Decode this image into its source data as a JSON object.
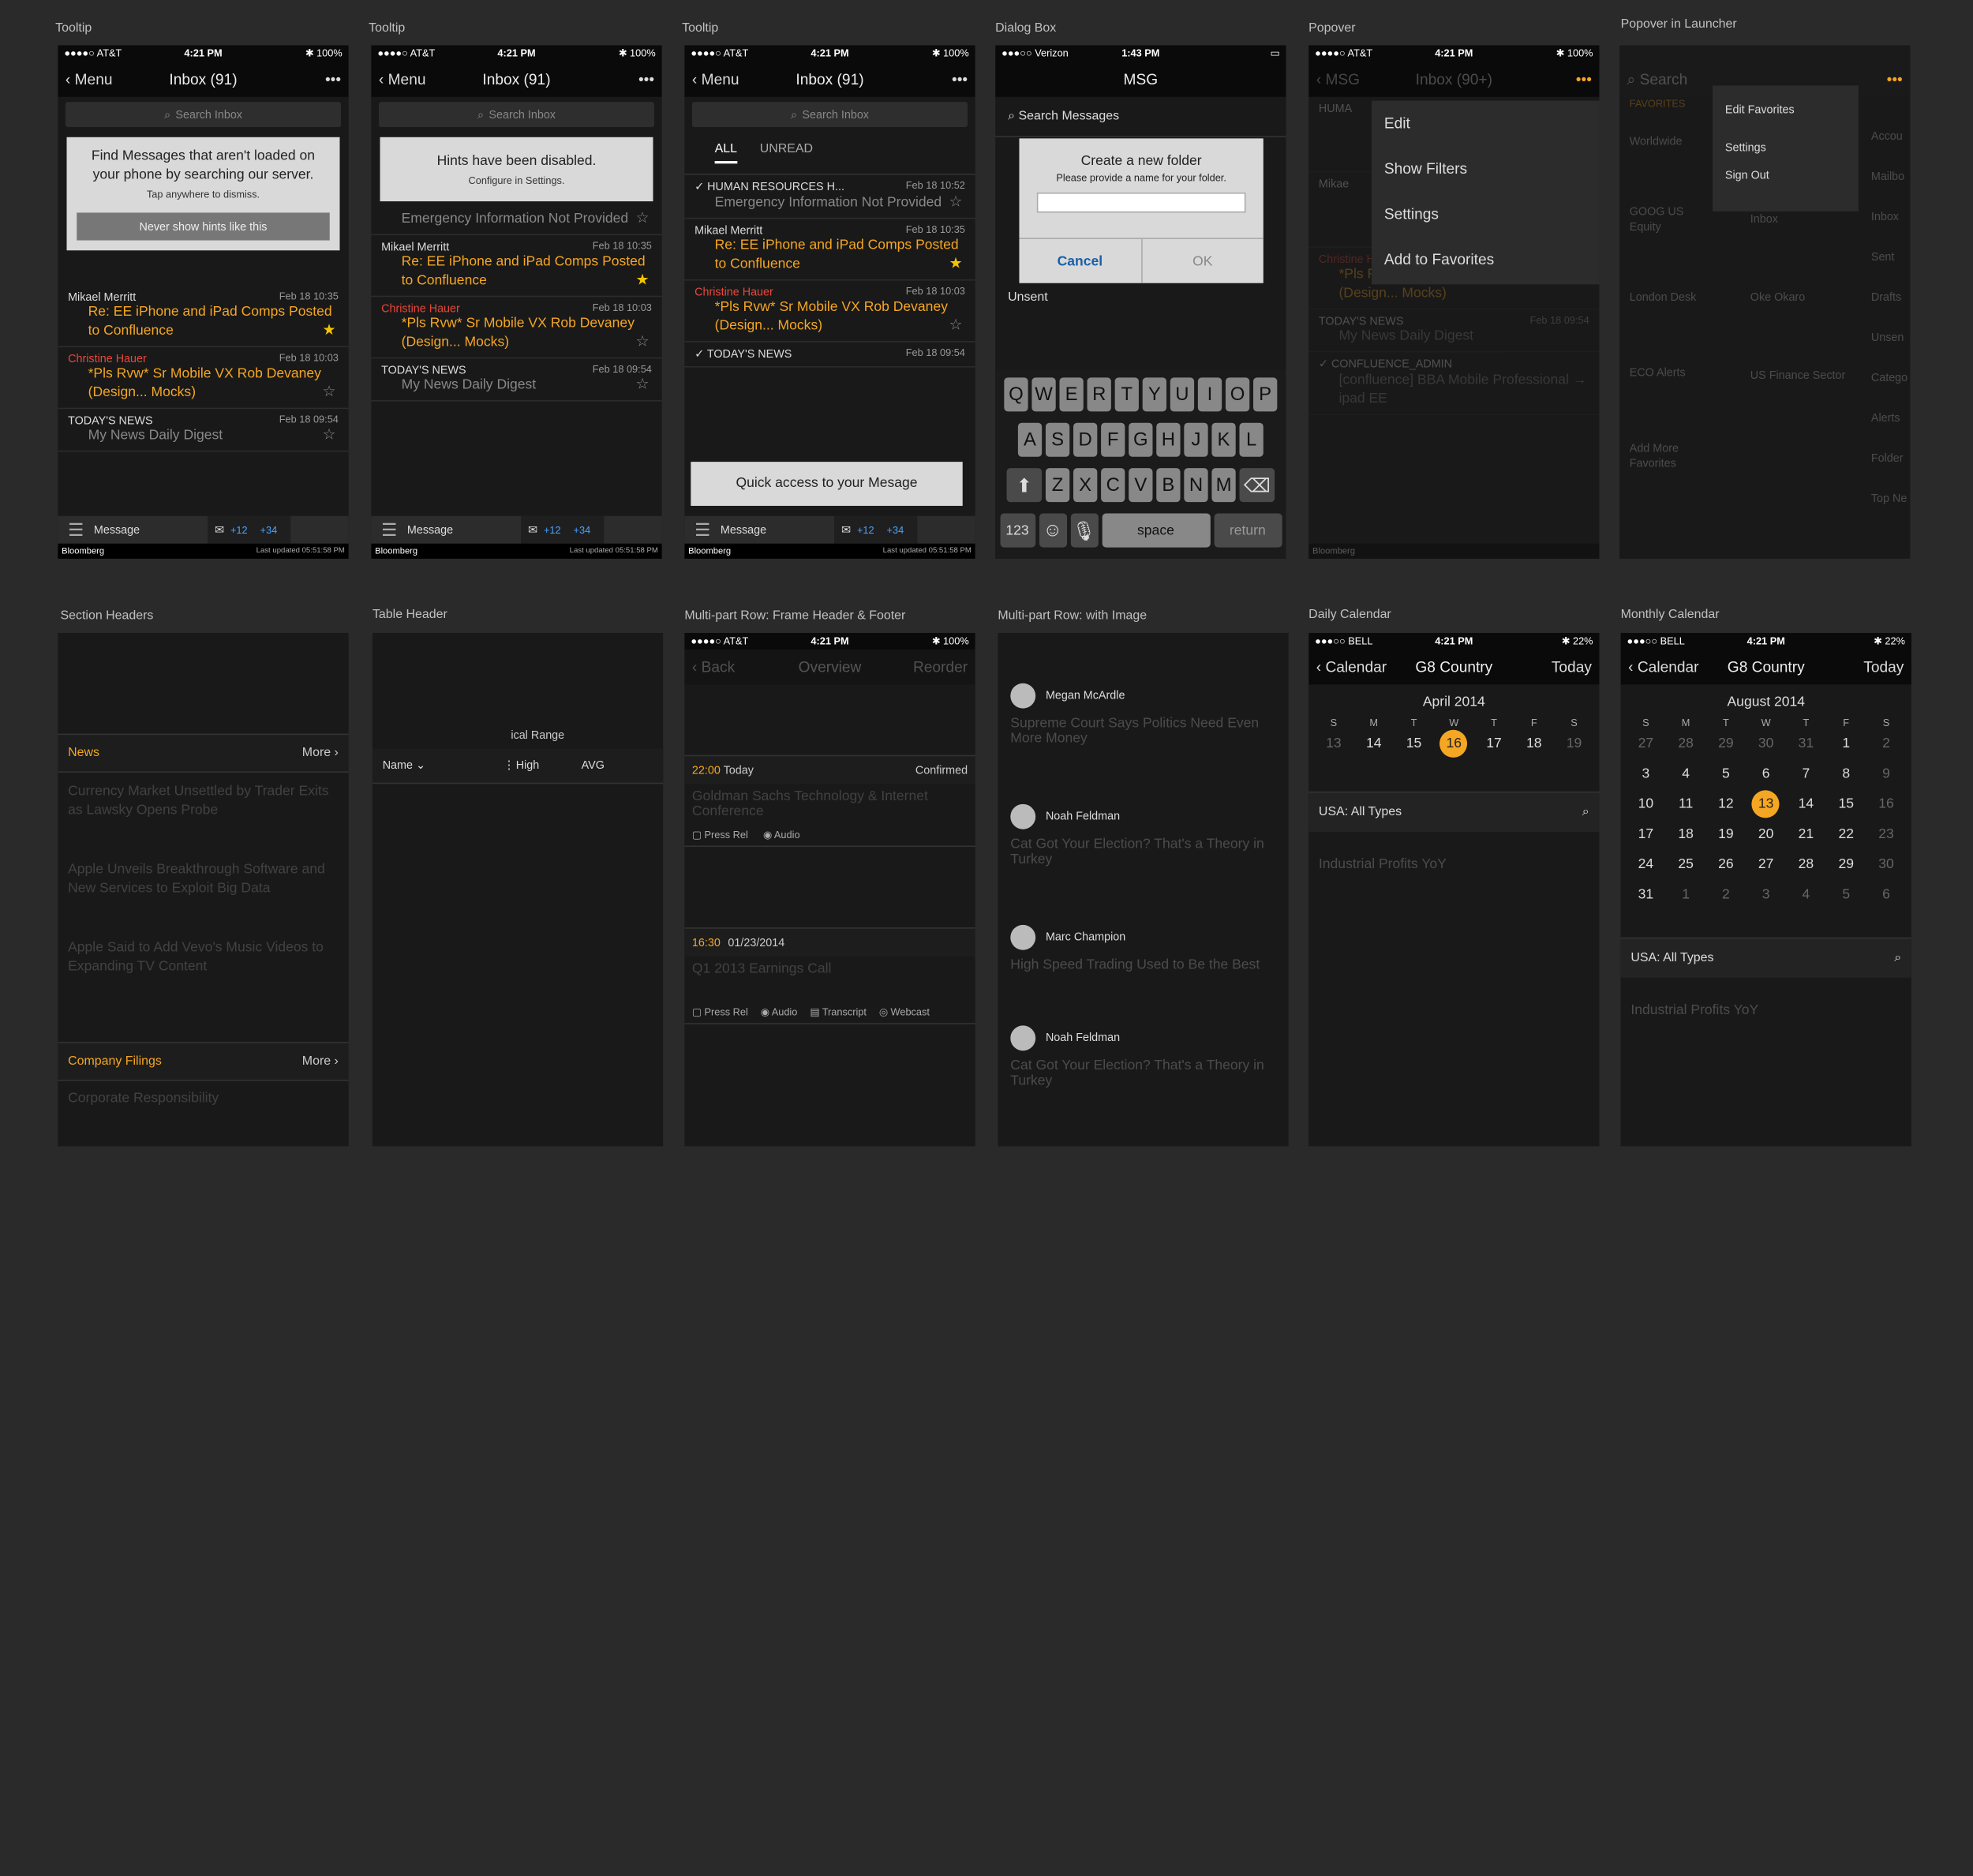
{
  "captions": {
    "c1": "Tooltip",
    "c2": "Tooltip",
    "c3": "Tooltip",
    "c4": "Dialog Box",
    "c5": "Popover",
    "c6": "Popover in Launcher",
    "c7": "Section Headers",
    "c8": "Table Header",
    "c9": "Multi-part Row: Frame Header & Footer",
    "c10": "Multi-part Row: with Image",
    "c11": "Daily Calendar",
    "c12": "Monthly Calendar"
  },
  "status": {
    "carrier": "●●●●○ AT&T",
    "time": "4:21 PM",
    "battery": "✱ 100%",
    "vz_carrier": "●●●○○ Verizon",
    "vz_time": "1:43 PM",
    "bell": "●●●○○ BELL",
    "bell_batt": "✱ 22%"
  },
  "inbox": {
    "back": "Menu",
    "title": "Inbox (91)",
    "more": "•••",
    "search": "Search Inbox"
  },
  "tips": {
    "t1_head": "Find Messages that aren't loaded on your phone by searching our server.",
    "t1_sub": "Tap anywhere to dismiss.",
    "t1_btn": "Never show hints like this",
    "t2_head": "Hints have been disabled.",
    "t2_sub": "Configure in Settings.",
    "t3": "Quick access to your Mesage"
  },
  "tabs": {
    "all": "ALL",
    "unread": "UNREAD"
  },
  "msgs": {
    "m0_from": "HUMAN RESOURCES H...",
    "m0_date": "Feb 18 10:52",
    "m0_sub": "Emergency Information Not Provided",
    "m1_from": "Mikael Merritt",
    "m1_date": "Feb 18 10:35",
    "m1_sub": "Re: EE iPhone and iPad Comps Posted to Confluence",
    "m2_from": "Christine Hauer",
    "m2_date": "Feb 18 10:03",
    "m2_sub": "*Pls Rvw* Sr Mobile VX Rob Devaney (Design... Mocks)",
    "m3_from": "TODAY'S NEWS",
    "m3_date": "Feb 18 09:54",
    "m3_sub": "My News Daily Digest"
  },
  "toolbar": {
    "menu": "☰",
    "label": "Message",
    "mail": "✉",
    "badge1": "+12",
    "badge2": "+34"
  },
  "footer": {
    "brand": "Bloomberg",
    "updated": "Last updated 05:51:58 PM"
  },
  "dialog": {
    "title": "MSG",
    "search": "Search Messages",
    "head": "Create a new folder",
    "sub": "Please provide a name for your folder.",
    "cancel": "Cancel",
    "ok": "OK",
    "unsent": "Unsent"
  },
  "keys": {
    "r1": [
      "Q",
      "W",
      "E",
      "R",
      "T",
      "Y",
      "U",
      "I",
      "O",
      "P"
    ],
    "r2": [
      "A",
      "S",
      "D",
      "F",
      "G",
      "H",
      "J",
      "K",
      "L"
    ],
    "r3": [
      "Z",
      "X",
      "C",
      "V",
      "B",
      "N",
      "M"
    ],
    "n123": "123",
    "space": "space",
    "ret": "return"
  },
  "popover": {
    "back": "MSG",
    "title": "Inbox (90+)",
    "items": [
      "Edit",
      "Show Filters",
      "Settings",
      "Add to Favorites"
    ]
  },
  "launcher": {
    "search": "Search",
    "items": [
      "Edit Favorites",
      "Settings",
      "Sign Out"
    ],
    "fav": "FAVORITES",
    "left": [
      "Worldwide",
      "GOOG US Equity",
      "London Desk",
      "ECO Alerts",
      "Add More Favorites"
    ],
    "mid": [
      "Inbox",
      "Oke Okaro",
      "US Finance Sector"
    ],
    "right": [
      "Accou",
      "Mailbo",
      "Inbox",
      "Sent",
      "Drafts",
      "Unsen",
      "Catego",
      "Alerts",
      "Folder",
      "Top Ne"
    ]
  },
  "sections": {
    "news": "News",
    "more": "More ›",
    "filings": "Company Filings",
    "more2": "More ›",
    "rows": [
      "Currency Market Unsettled by Trader Exits as Lawsky Opens Probe",
      "Apple Unveils Breakthrough Software and New Services to Exploit Big Data",
      "Apple Said to Add Vevo's Music Videos to Expanding TV Content",
      "Corporate Responsibility"
    ]
  },
  "table": {
    "range": "ical Range",
    "name": "Name ⌄",
    "high": "High",
    "avg": "AVG"
  },
  "multi": {
    "back": "Back",
    "title": "Overview",
    "reorder": "Reorder",
    "r1_time": "22:00",
    "r1_day": "Today",
    "r1_status": "Confirmed",
    "r1_sub": "Goldman Sachs Technology & Internet Conference",
    "press": "Press Rel",
    "audio": "Audio",
    "r2_time": "16:30",
    "r2_date": "01/23/2014",
    "r2_sub": "Q1 2013 Earnings Call",
    "transcript": "Transcript",
    "webcast": "Webcast"
  },
  "people": [
    {
      "name": "Megan McArdle",
      "text": "Supreme Court Says Politics Need Even More Money"
    },
    {
      "name": "Noah Feldman",
      "text": "Cat Got Your Election? That's a Theory in Turkey"
    },
    {
      "name": "Marc Champion",
      "text": "High Speed Trading Used to Be the Best"
    },
    {
      "name": "Noah Feldman",
      "text": "Cat Got Your Election? That's a Theory in Turkey"
    }
  ],
  "cal": {
    "back": "Calendar",
    "title": "G8 Country",
    "today": "Today",
    "daily_month": "April 2014",
    "monthly_month": "August 2014",
    "week": [
      "S",
      "M",
      "T",
      "W",
      "T",
      "F",
      "S"
    ],
    "daily": [
      "13",
      "14",
      "15",
      "16",
      "17",
      "18",
      "19"
    ],
    "types": "USA: All Types",
    "event": "Industrial Profits YoY"
  },
  "monthly": [
    [
      "27",
      "28",
      "29",
      "30",
      "31",
      "1",
      "2"
    ],
    [
      "3",
      "4",
      "5",
      "6",
      "7",
      "8",
      "9"
    ],
    [
      "10",
      "11",
      "12",
      "13",
      "14",
      "15",
      "16"
    ],
    [
      "17",
      "18",
      "19",
      "20",
      "21",
      "22",
      "23"
    ],
    [
      "24",
      "25",
      "26",
      "27",
      "28",
      "29",
      "30"
    ],
    [
      "31",
      "1",
      "2",
      "3",
      "4",
      "5",
      "6"
    ]
  ],
  "colors": {
    "accent": "#f5a623",
    "red": "#e8473b",
    "blue": "#4aa3ff"
  }
}
